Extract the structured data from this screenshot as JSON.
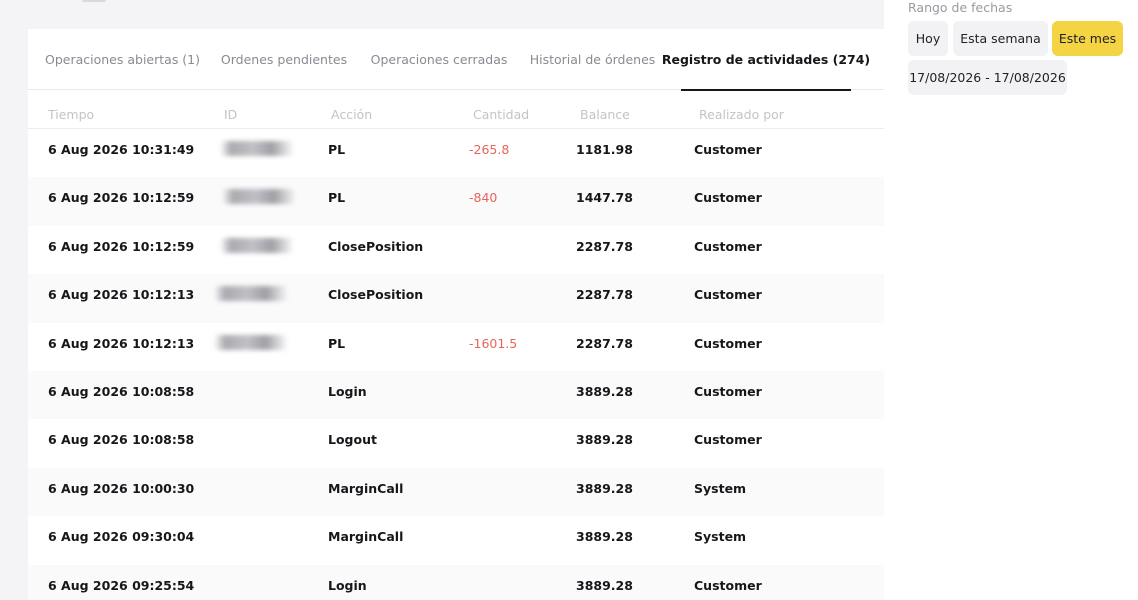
{
  "tabs": [
    {
      "label": "Operaciones abiertas (1)"
    },
    {
      "label": "Ordenes pendientes"
    },
    {
      "label": "Operaciones cerradas"
    },
    {
      "label": "Historial de órdenes"
    },
    {
      "label": "Registro de actividades (274)"
    }
  ],
  "active_tab": 4,
  "table": {
    "headers": [
      "Tiempo",
      "ID",
      "Acción",
      "Cantidad",
      "Balance",
      "Realizado por"
    ],
    "rows": [
      {
        "time": "6 Aug 2026 10:31:49",
        "id_redacted": true,
        "action": "PL",
        "amount": "-265.8",
        "balance": "1181.98",
        "by": "Customer"
      },
      {
        "time": "6 Aug 2026 10:12:59",
        "id_redacted": true,
        "action": "PL",
        "amount": "-840",
        "balance": "1447.78",
        "by": "Customer"
      },
      {
        "time": "6 Aug 2026 10:12:59",
        "id_redacted": true,
        "action": "ClosePosition",
        "amount": "",
        "balance": "2287.78",
        "by": "Customer"
      },
      {
        "time": "6 Aug 2026 10:12:13",
        "id_redacted": true,
        "action": "ClosePosition",
        "amount": "",
        "balance": "2287.78",
        "by": "Customer"
      },
      {
        "time": "6 Aug 2026 10:12:13",
        "id_redacted": true,
        "action": "PL",
        "amount": "-1601.5",
        "balance": "2287.78",
        "by": "Customer"
      },
      {
        "time": "6 Aug 2026 10:08:58",
        "id_redacted": false,
        "action": "Login",
        "amount": "",
        "balance": "3889.28",
        "by": "Customer"
      },
      {
        "time": "6 Aug 2026 10:08:58",
        "id_redacted": false,
        "action": "Logout",
        "amount": "",
        "balance": "3889.28",
        "by": "Customer"
      },
      {
        "time": "6 Aug 2026 10:00:30",
        "id_redacted": false,
        "action": "MarginCall",
        "amount": "",
        "balance": "3889.28",
        "by": "System"
      },
      {
        "time": "6 Aug 2026 09:30:04",
        "id_redacted": false,
        "action": "MarginCall",
        "amount": "",
        "balance": "3889.28",
        "by": "System"
      },
      {
        "time": "6 Aug 2026 09:25:54",
        "id_redacted": false,
        "action": "Login",
        "amount": "",
        "balance": "3889.28",
        "by": "Customer"
      }
    ]
  },
  "date_filter": {
    "label": "Rango de fechas",
    "options": [
      "Hoy",
      "Esta semana",
      "Este mes"
    ],
    "selected": "Este mes",
    "range": "17/08/2026 - 17/08/2026"
  },
  "colors": {
    "accent": "#f5d443",
    "negative": "#e8645a"
  }
}
